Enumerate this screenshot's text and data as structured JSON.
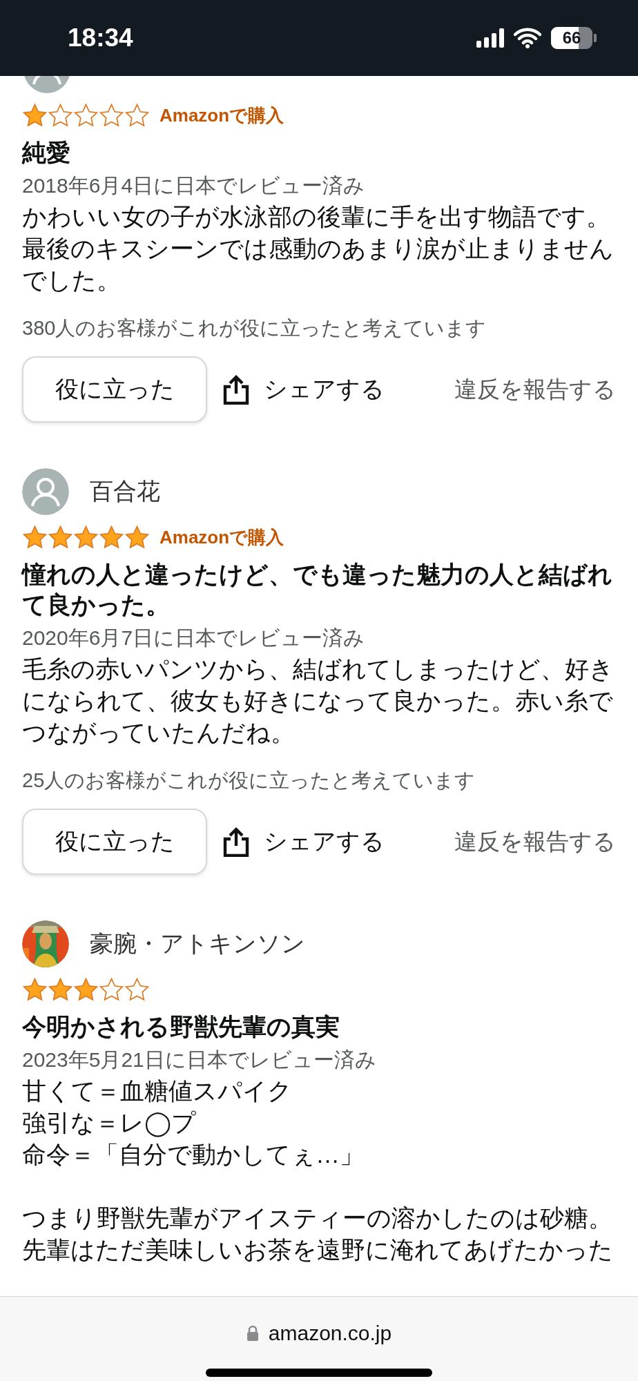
{
  "status_bar": {
    "time": "18:34",
    "battery": "66"
  },
  "reviews": [
    {
      "avatar": {
        "kind": "default"
      },
      "stars": 1,
      "purchase": "Amazonで購入",
      "title": "純愛",
      "date": "2018年6月4日に日本でレビュー済み",
      "paragraphs": [
        [
          "かわいい女の子が水泳部の後輩に手を出す物語です。最後のキスシーンでは感動のあまり涙が止まりませんでした。"
        ]
      ],
      "helpful_count": "380人のお客様がこれが役に立ったと考えています",
      "actions": {
        "helpful": "役に立った",
        "share": "シェアする",
        "report": "違反を報告する"
      }
    },
    {
      "name": "百合花",
      "avatar": {
        "kind": "default"
      },
      "stars": 5,
      "purchase": "Amazonで購入",
      "title": "憧れの人と違ったけど、でも違った魅力の人と結ばれて良かった。",
      "date": "2020年6月7日に日本でレビュー済み",
      "paragraphs": [
        [
          "毛糸の赤いパンツから、結ばれてしまったけど、好きになられて、彼女も好きになって良かった。赤い糸でつながっていたんだね。"
        ]
      ],
      "helpful_count": "25人のお客様がこれが役に立ったと考えています",
      "actions": {
        "helpful": "役に立った",
        "share": "シェアする",
        "report": "違反を報告する"
      }
    },
    {
      "name": "豪腕・アトキンソン",
      "avatar": {
        "kind": "picture"
      },
      "stars": 3,
      "title": "今明かされる野獣先輩の真実",
      "date": "2023年5月21日に日本でレビュー済み",
      "paragraphs": [
        [
          "甘くて＝血糖値スパイク",
          "強引な＝レ◯プ",
          "命令＝「自分で動かしてぇ…」"
        ],
        [
          "つまり野獣先輩がアイスティーの溶かしたのは砂糖。先輩はただ美味しいお茶を遠野に淹れてあげたかった"
        ]
      ]
    }
  ],
  "address_bar": {
    "url": "amazon.co.jp"
  }
}
